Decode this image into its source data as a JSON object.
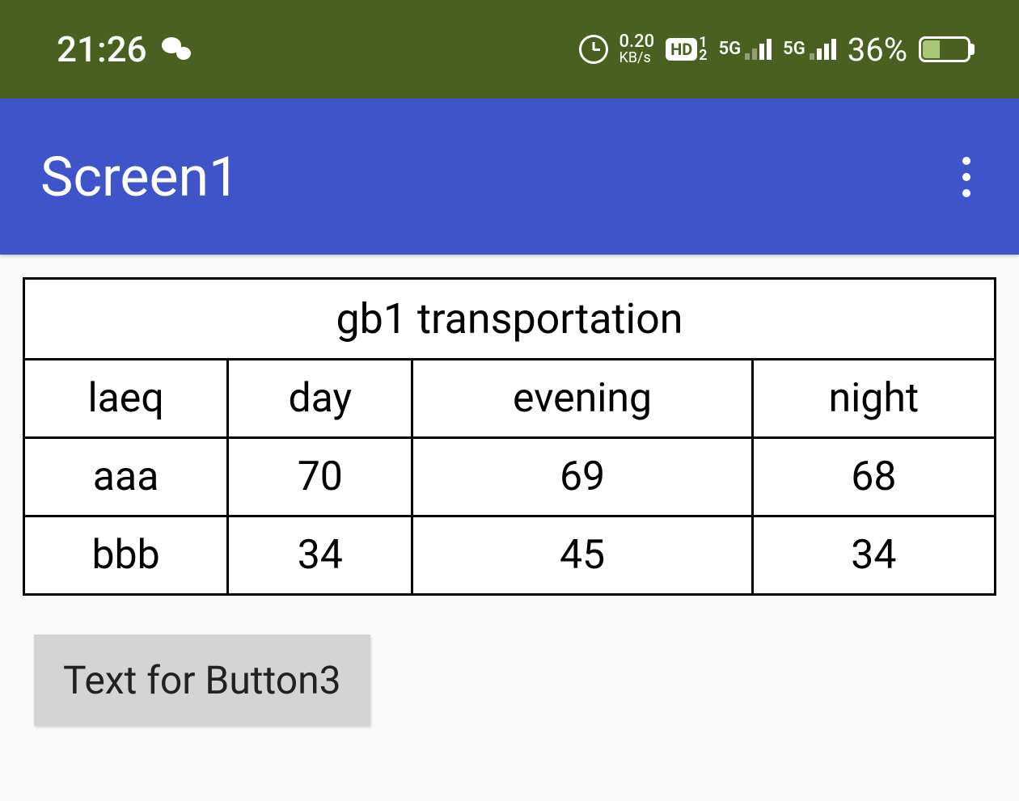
{
  "status_bar": {
    "time": "21:26",
    "speed_value": "0.20",
    "speed_unit": "KB/s",
    "hd_label": "HD",
    "hd_sim1": "1",
    "hd_sim2": "2",
    "signal1_label": "5G",
    "signal2_label": "5G",
    "battery_percent": "36%"
  },
  "app_bar": {
    "title": "Screen1"
  },
  "table": {
    "title": "gb1 transportation",
    "headers": [
      "laeq",
      "day",
      "evening",
      "night"
    ],
    "rows": [
      {
        "label": "aaa",
        "day": "70",
        "evening": "69",
        "night": "68"
      },
      {
        "label": "bbb",
        "day": "34",
        "evening": "45",
        "night": "34"
      }
    ]
  },
  "buttons": {
    "button3_label": "Text for Button3"
  },
  "chart_data": {
    "type": "table",
    "title": "gb1 transportation",
    "categories": [
      "day",
      "evening",
      "night"
    ],
    "series": [
      {
        "name": "aaa",
        "values": [
          70,
          69,
          68
        ]
      },
      {
        "name": "bbb",
        "values": [
          34,
          45,
          34
        ]
      }
    ],
    "row_header_label": "laeq"
  }
}
